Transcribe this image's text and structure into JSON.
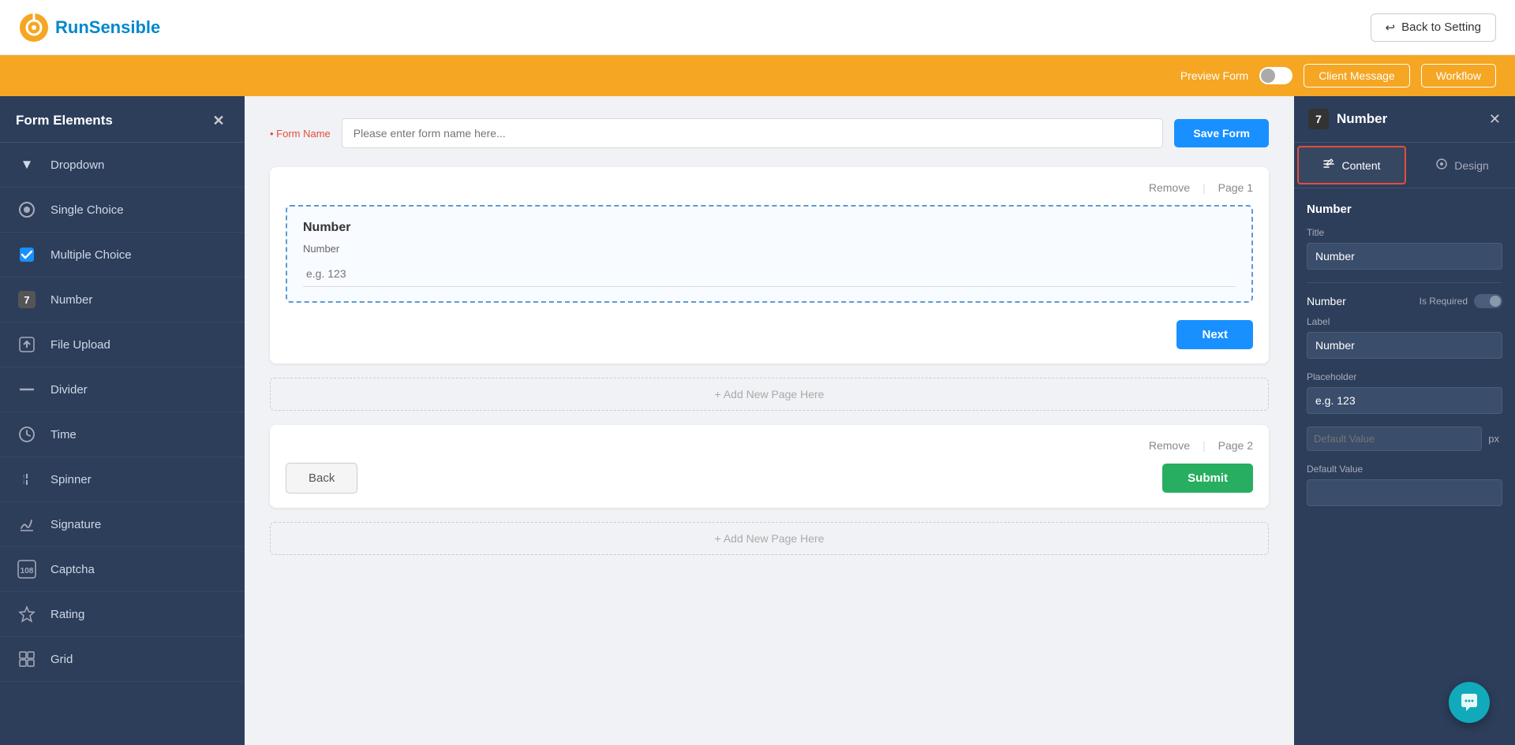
{
  "app": {
    "name": "RunSensible",
    "logo_color": "#f5a623"
  },
  "header": {
    "back_to_setting": "Back to Setting"
  },
  "orange_bar": {
    "preview_form_label": "Preview Form",
    "client_message_btn": "Client Message",
    "workflow_btn": "Workflow"
  },
  "sidebar": {
    "title": "Form Elements",
    "items": [
      {
        "id": "dropdown",
        "label": "Dropdown",
        "icon": "▼"
      },
      {
        "id": "single-choice",
        "label": "Single Choice",
        "icon": "○"
      },
      {
        "id": "multiple-choice",
        "label": "Multiple Choice",
        "icon": "☑"
      },
      {
        "id": "number",
        "label": "Number",
        "icon": "7"
      },
      {
        "id": "file-upload",
        "label": "File Upload",
        "icon": "⬆"
      },
      {
        "id": "divider",
        "label": "Divider",
        "icon": "—"
      },
      {
        "id": "time",
        "label": "Time",
        "icon": "🕐"
      },
      {
        "id": "spinner",
        "label": "Spinner",
        "icon": "⇅"
      },
      {
        "id": "signature",
        "label": "Signature",
        "icon": "✏"
      },
      {
        "id": "captcha",
        "label": "Captcha",
        "icon": "🔒"
      },
      {
        "id": "rating",
        "label": "Rating",
        "icon": "★"
      },
      {
        "id": "grid",
        "label": "Grid",
        "icon": "⊞"
      }
    ]
  },
  "form": {
    "name_label": "• Form Name",
    "name_placeholder": "Please enter form name here...",
    "save_btn": "Save Form",
    "page1": {
      "remove_label": "Remove",
      "page_label": "Page 1",
      "number_card": {
        "title": "Number",
        "field_label": "Number",
        "placeholder": "e.g. 123"
      },
      "next_btn": "Next"
    },
    "add_page_label": "+ Add New Page Here",
    "page2": {
      "remove_label": "Remove",
      "page_label": "Page 2",
      "back_btn": "Back",
      "submit_btn": "Submit"
    },
    "add_page2_label": "+ Add New Page Here"
  },
  "right_panel": {
    "badge": "7",
    "title": "Number",
    "content_tab": "Content",
    "design_tab": "Design",
    "section_label": "Number",
    "title_label": "Title",
    "title_value": "Number",
    "number_section_label": "Number",
    "is_required_label": "Is Required",
    "label_label": "Label",
    "label_value": "Number",
    "placeholder_label": "Placeholder",
    "placeholder_value": "e.g. 123",
    "default_value_label": "Default Value",
    "px_label": "px",
    "default_value_label2": "Default Value",
    "default_value_input": ""
  }
}
